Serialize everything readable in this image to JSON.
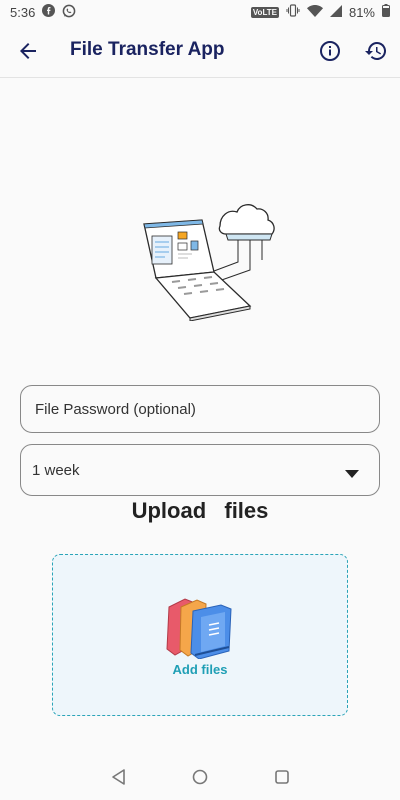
{
  "status_bar": {
    "time": "5:36",
    "network": "VoLTE",
    "battery": "81%",
    "icons": [
      "facebook-icon",
      "whatsapp-icon",
      "vibrate-icon",
      "wifi-icon",
      "signal-icon",
      "battery-icon"
    ]
  },
  "app_bar": {
    "title": "File Transfer App",
    "icons": [
      "back-arrow-icon",
      "info-icon",
      "history-icon"
    ]
  },
  "form": {
    "password_placeholder": "File Password (optional)",
    "password_value": "",
    "expiry_selected": "1 week"
  },
  "upload": {
    "heading": "Upload  files",
    "add_label": "Add files"
  },
  "colors": {
    "title": "#1a2360",
    "accent": "#2aa4b8",
    "dropzone_bg": "#eef6fb"
  },
  "nav_bar": {
    "icons": [
      "nav-back-icon",
      "nav-home-icon",
      "nav-recents-icon"
    ]
  }
}
